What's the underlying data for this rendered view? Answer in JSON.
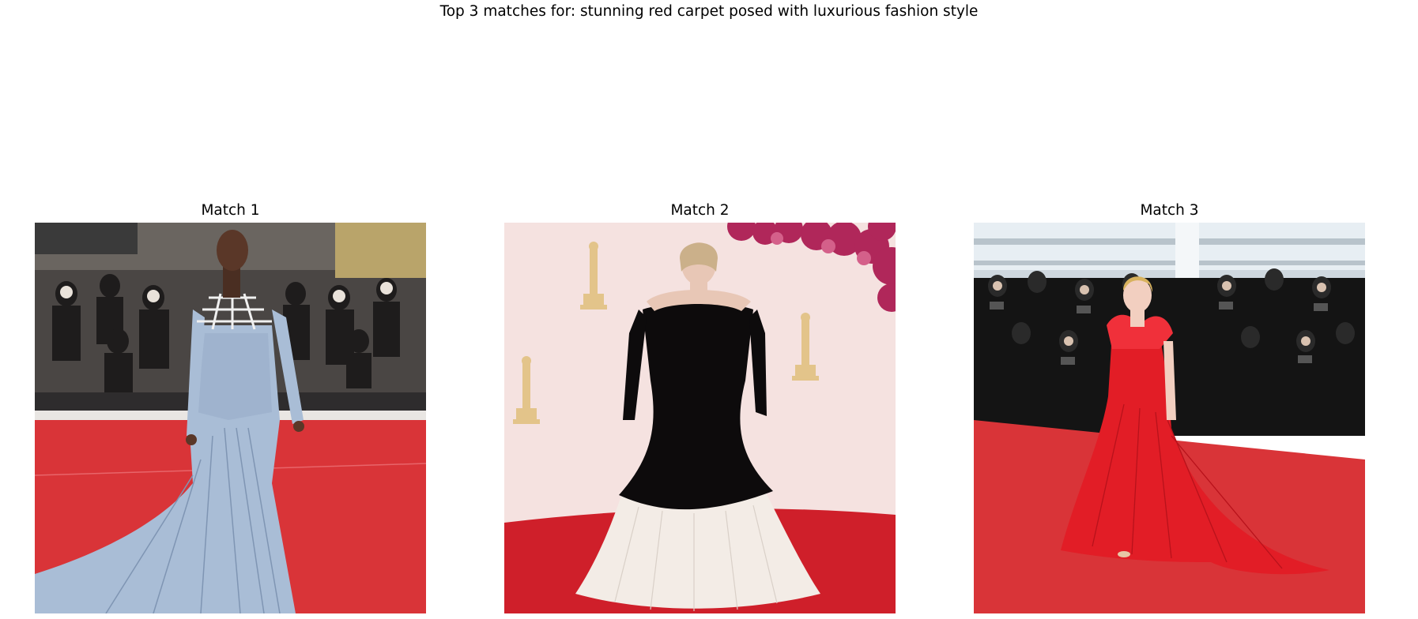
{
  "figure": {
    "title": "Top 3 matches for: stunning red carpet posed with luxurious fashion style"
  },
  "matches": [
    {
      "title": "Match 1"
    },
    {
      "title": "Match 2"
    },
    {
      "title": "Match 3"
    }
  ],
  "colors": {
    "red_carpet": "#d93438",
    "gown_blue": "#a9bdd6",
    "gown_black": "#0d0b0c",
    "gown_tulle": "#f3ece6",
    "gown_red": "#e21d26",
    "backdrop_pink": "#f3dcdc",
    "award_gold": "#e3c48a"
  }
}
